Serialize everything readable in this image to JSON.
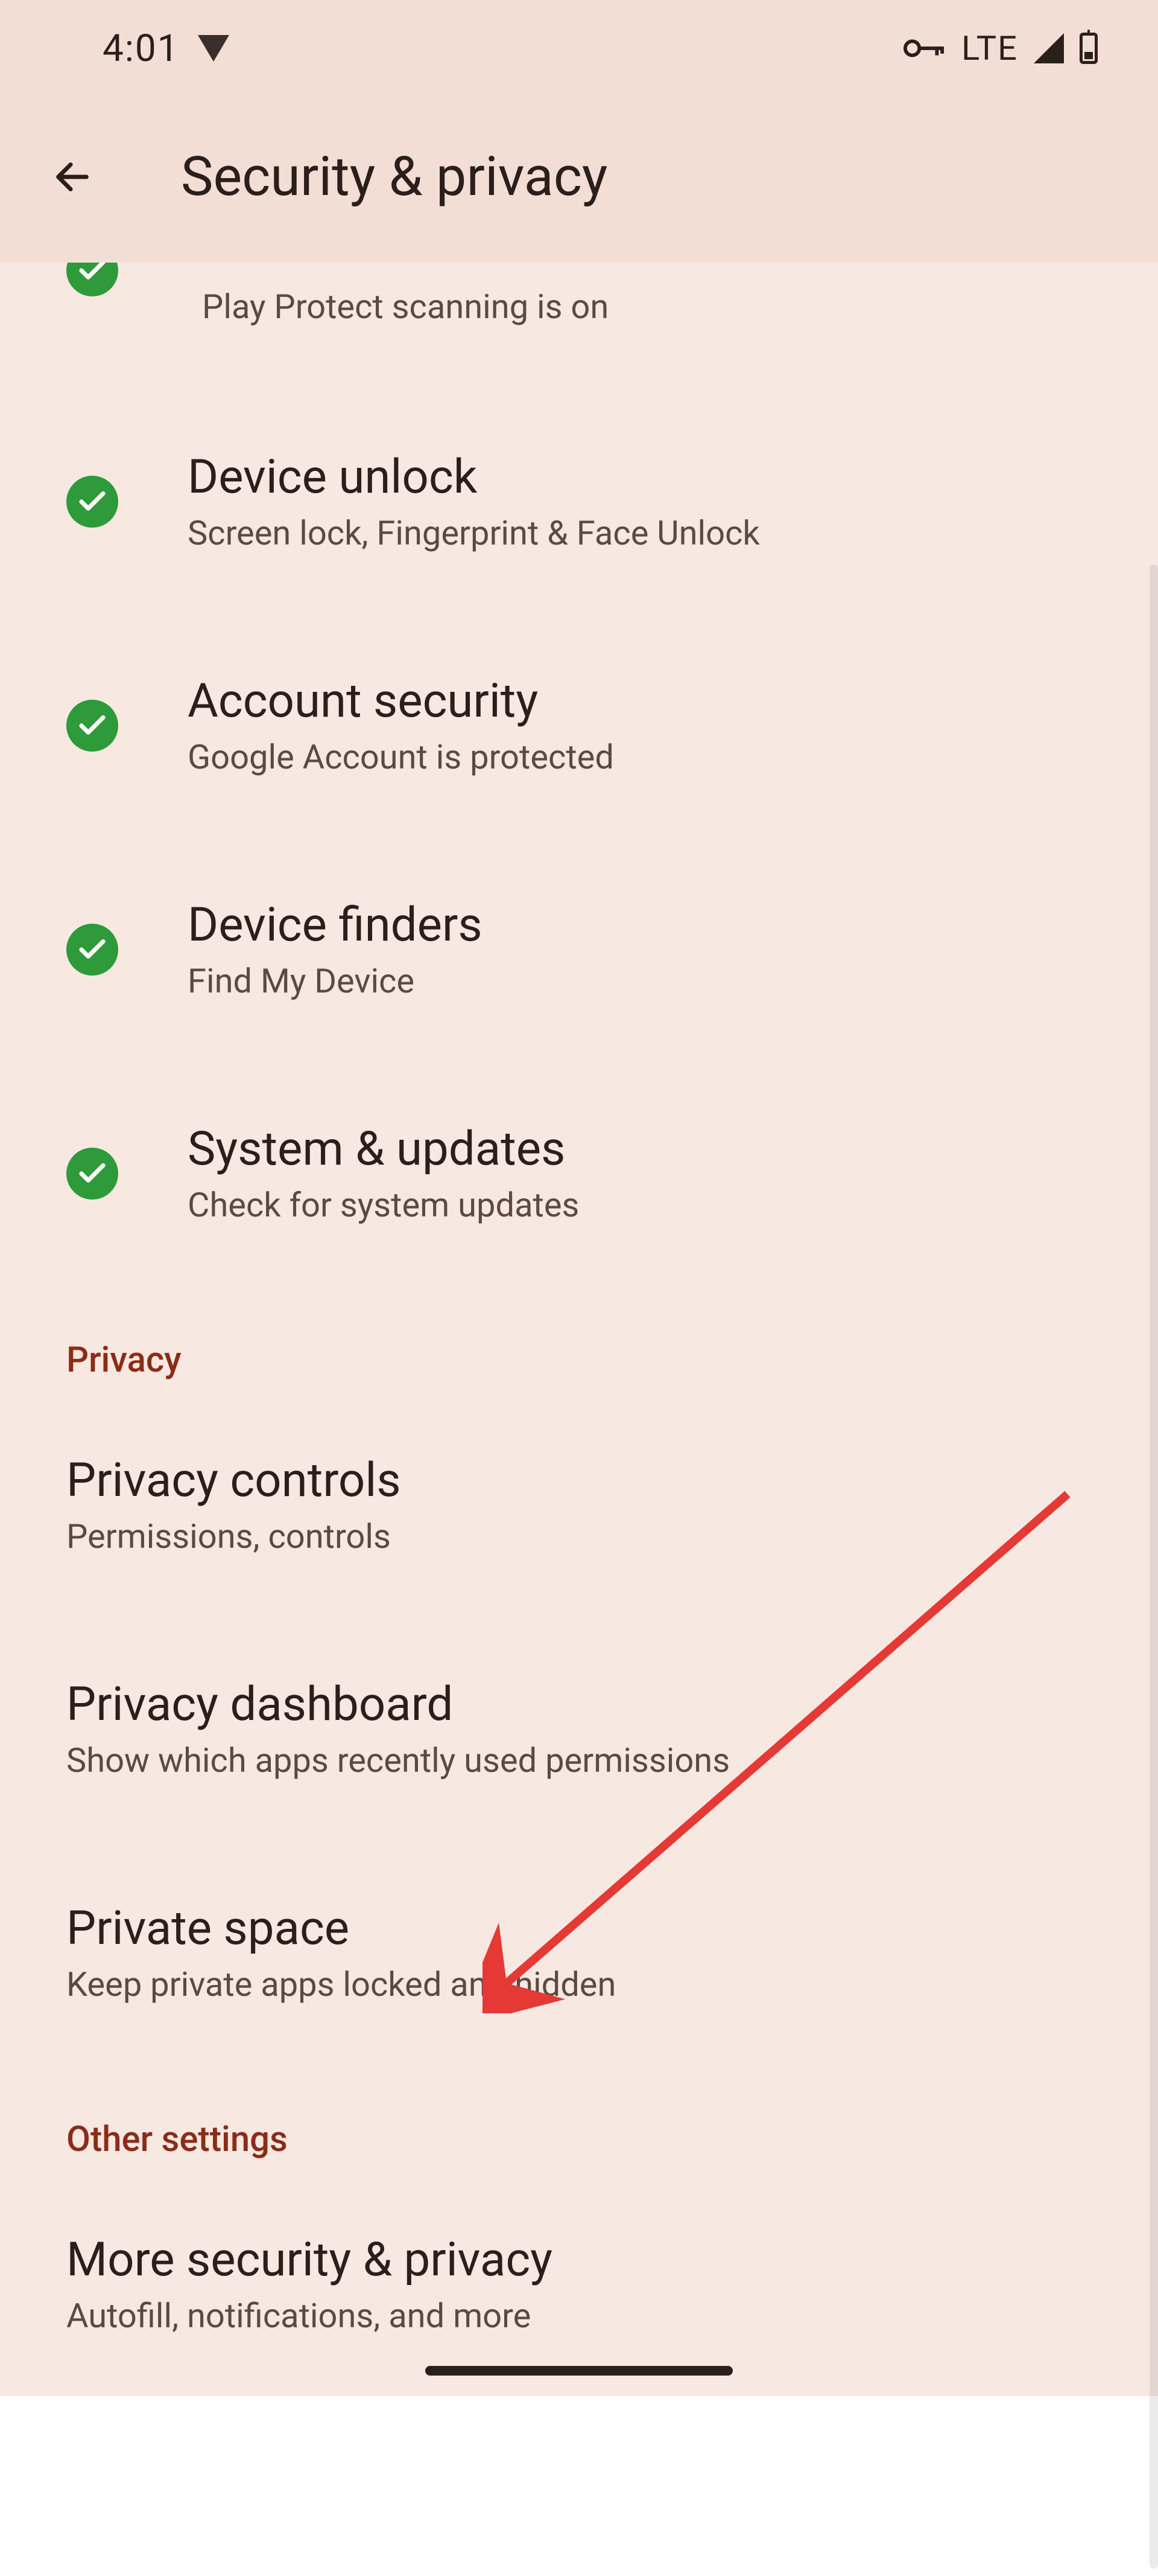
{
  "statusbar": {
    "time": "4:01",
    "network_label": "LTE"
  },
  "appbar": {
    "title": "Security & privacy"
  },
  "partial_top": {
    "subtitle": "Play Protect scanning is on"
  },
  "security_items": [
    {
      "title": "Device unlock",
      "subtitle": "Screen lock, Fingerprint & Face Unlock"
    },
    {
      "title": "Account security",
      "subtitle": "Google Account is protected"
    },
    {
      "title": "Device finders",
      "subtitle": "Find My Device"
    },
    {
      "title": "System & updates",
      "subtitle": "Check for system updates"
    }
  ],
  "sections": {
    "privacy_header": "Privacy",
    "other_header": "Other settings"
  },
  "privacy_items": [
    {
      "title": "Privacy controls",
      "subtitle": "Permissions, controls"
    },
    {
      "title": "Privacy dashboard",
      "subtitle": "Show which apps recently used permissions"
    },
    {
      "title": "Private space",
      "subtitle": "Keep private apps locked and hidden"
    }
  ],
  "other_items": [
    {
      "title": "More security & privacy",
      "subtitle": "Autofill, notifications, and more"
    }
  ],
  "annotation": {
    "color": "#e53935"
  }
}
